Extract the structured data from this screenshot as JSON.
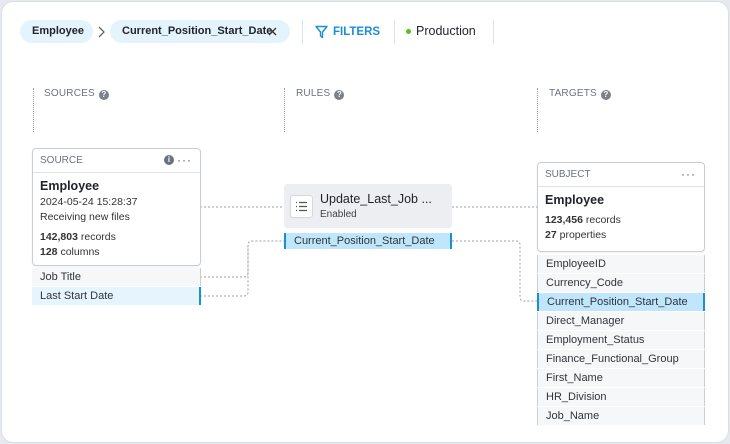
{
  "breadcrumb": {
    "root": "Employee",
    "current": "Current_Position_Start_Date"
  },
  "toolbar": {
    "filters_label": "FILTERS",
    "environment": "Production",
    "env_status_color": "#52c41a",
    "accent": "#1a8fd6"
  },
  "columns": {
    "sources": "SOURCES",
    "rules": "RULES",
    "targets": "TARGETS"
  },
  "source": {
    "header": "SOURCE",
    "name": "Employee",
    "timestamp": "2024-05-24 15:28:37",
    "status": "Receiving new files",
    "records_count": "142,803",
    "records_label": " records",
    "columns_count": "128",
    "columns_label": " columns",
    "fields": [
      "Job Title",
      "Last Start Date"
    ]
  },
  "rule": {
    "name": "Update_Last_Job ...",
    "status": "Enabled",
    "field": "Current_Position_Start_Date"
  },
  "subject": {
    "header": "SUBJECT",
    "name": "Employee",
    "records_count": "123,456",
    "records_label": " records",
    "properties_count": "27",
    "properties_label": " properties",
    "fields": [
      "EmployeeID",
      "Currency_Code",
      "Current_Position_Start_Date",
      "Direct_Manager",
      "Employment_Status",
      "Finance_Functional_Group",
      "First_Name",
      "HR_Division",
      "Job_Name"
    ],
    "selected_field": "Current_Position_Start_Date"
  }
}
